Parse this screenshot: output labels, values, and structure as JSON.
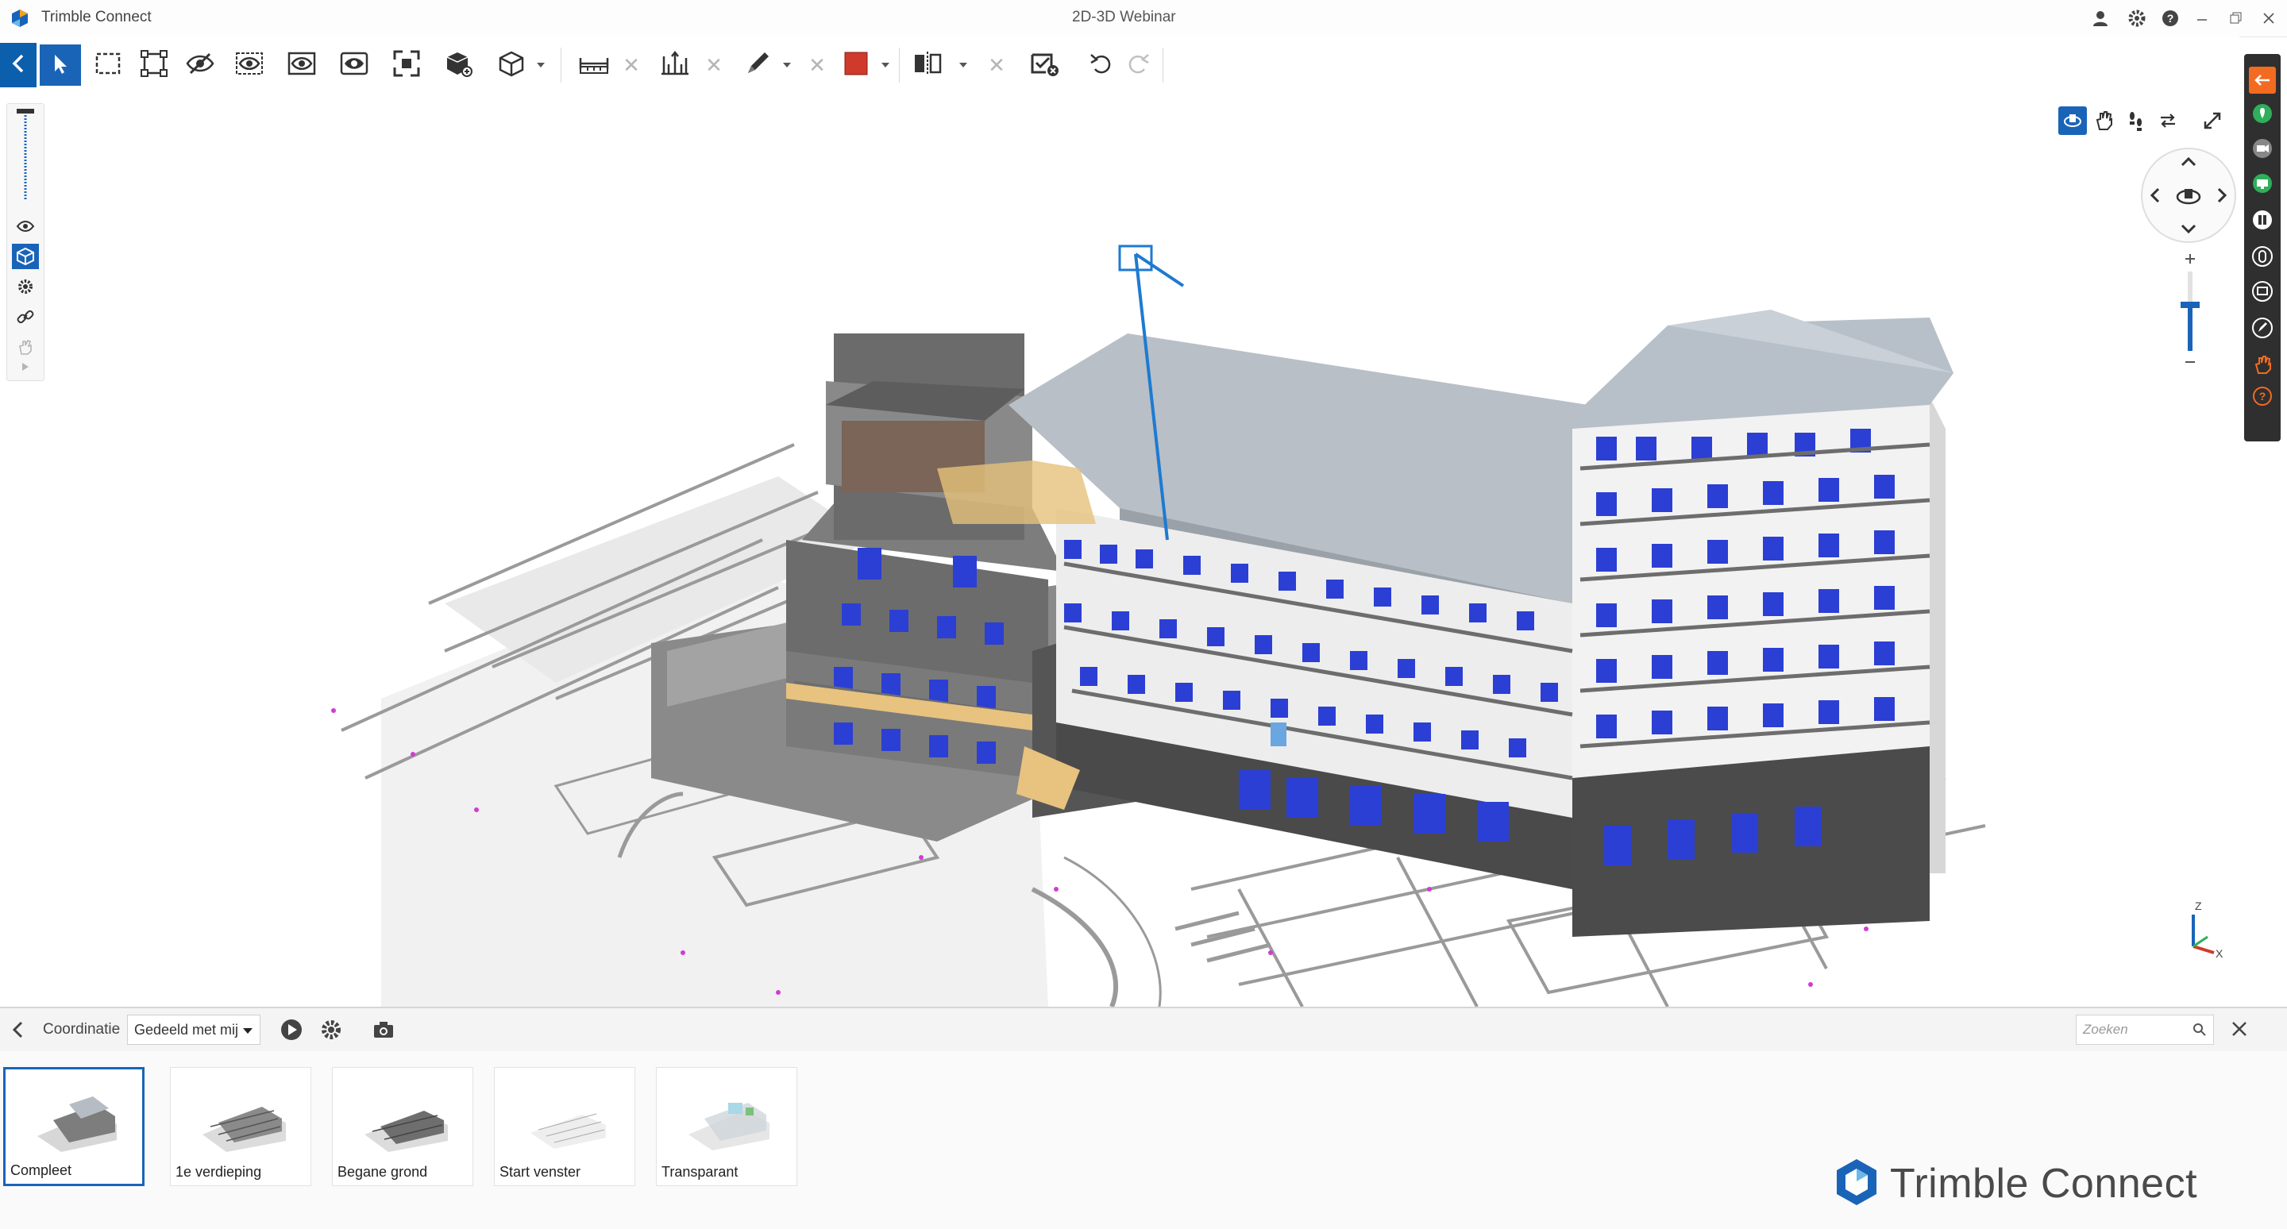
{
  "app": {
    "title": "Trimble Connect",
    "window_title": "2D-3D Webinar"
  },
  "colors": {
    "accent": "#0b5fad",
    "orange": "#f26b21",
    "green": "#2fae5c",
    "red": "#d03a2a",
    "dark_strip": "#2f2f2f",
    "window_glass": "#2b3fd4"
  },
  "titlebar_icons": [
    "user-icon",
    "gear-icon",
    "help-icon",
    "minimize-icon",
    "restore-icon",
    "close-icon"
  ],
  "toolbar": {
    "tools": [
      "back-icon",
      "select-icon",
      "box-select-icon",
      "fit-selection-icon",
      "hide-icon",
      "isolate-icon",
      "ghost-icon",
      "show-all-icon",
      "fit-all-icon",
      "object-properties-icon",
      "view-cube-icon",
      "measure-icon",
      "section-plane-icon",
      "markup-pen-icon",
      "color-swatch-icon",
      "clip-icon",
      "clash-icon",
      "undo-icon",
      "redo-icon"
    ]
  },
  "viewer": {
    "nav_tools": [
      "orbit-icon",
      "pan-icon",
      "walk-icon",
      "swap-icon",
      "fullscreen-icon"
    ],
    "axis": {
      "z": "Z",
      "x": "X"
    }
  },
  "right_panel": {
    "icons": [
      "arrow-icon",
      "location-icon",
      "video-icon",
      "screen-share-icon",
      "pause-icon",
      "mouse-icon",
      "chat-icon",
      "pen-icon",
      "hand-icon",
      "help-icon"
    ]
  },
  "bottom_panel": {
    "label": "Coordinatie",
    "select_value": "Gedeeld met mij",
    "search_placeholder": "Zoeken",
    "views": [
      {
        "label": "Compleet",
        "selected": true
      },
      {
        "label": "1e verdieping",
        "selected": false
      },
      {
        "label": "Begane grond",
        "selected": false
      },
      {
        "label": "Start venster",
        "selected": false
      },
      {
        "label": "Transparant",
        "selected": false
      }
    ]
  },
  "brand": {
    "text": "Trimble Connect"
  }
}
